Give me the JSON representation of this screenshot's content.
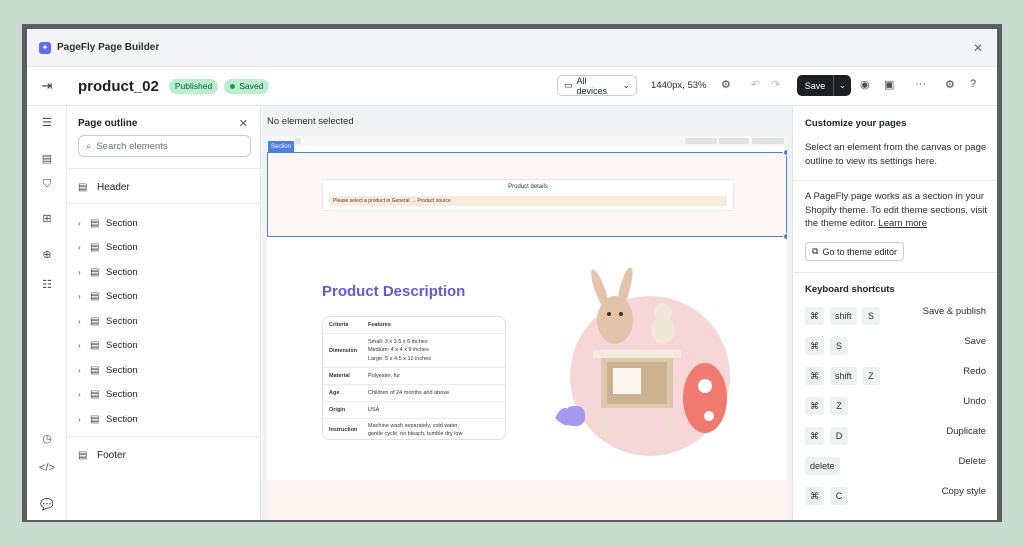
{
  "app": {
    "title": "PageFly Page Builder"
  },
  "topbar": {
    "page_name": "product_02",
    "status_published": "Published",
    "status_saved": "Saved",
    "device_select": "All devices",
    "zoom": "1440px, 53%",
    "save_label": "Save"
  },
  "outline": {
    "title": "Page outline",
    "search_placeholder": "Search elements",
    "header": "Header",
    "footer": "Footer",
    "sections": [
      "Section",
      "Section",
      "Section",
      "Section",
      "Section",
      "Section",
      "Section",
      "Section",
      "Section"
    ]
  },
  "canvas": {
    "status": "No element selected",
    "section_tag": "Section",
    "product_details_title": "Product details",
    "product_warning": "Please select a product in General → Product source",
    "description_title": "Product Description",
    "spec_header": [
      "Criteria",
      "Features"
    ],
    "spec_rows": [
      {
        "k": "Dimension",
        "v": "Small: 3 x 3.5 x 6 inches\nMedium: 4 x 4 x 9 inches\nLarge: 5 x 4.5 x 12 inches"
      },
      {
        "k": "Material",
        "v": "Polyester, fur"
      },
      {
        "k": "Age",
        "v": "Children of 24 months and above"
      },
      {
        "k": "Origin",
        "v": "USA"
      },
      {
        "k": "Instruction",
        "v": "Machine wash separately, cold water,\ngentle cycle, no bleach, tumble dry low"
      }
    ]
  },
  "panel": {
    "title": "Customize your pages",
    "intro": "Select an element from the canvas or page outline to view its settings here.",
    "theme_text": "A PageFly page works as a section in your Shopify theme. To edit theme sections, visit the theme editor.",
    "learn_more": "Learn more",
    "theme_editor_button": "Go to theme editor",
    "shortcuts_title": "Keyboard shortcuts",
    "shortcuts": [
      {
        "keys": [
          "⌘",
          "shift",
          "S"
        ],
        "label": "Save & publish"
      },
      {
        "keys": [
          "⌘",
          "S"
        ],
        "label": "Save"
      },
      {
        "keys": [
          "⌘",
          "shift",
          "Z"
        ],
        "label": "Redo"
      },
      {
        "keys": [
          "⌘",
          "Z"
        ],
        "label": "Undo"
      },
      {
        "keys": [
          "⌘",
          "D"
        ],
        "label": "Duplicate"
      },
      {
        "keys": [
          "delete"
        ],
        "label": "Delete"
      },
      {
        "keys": [
          "⌘",
          "C"
        ],
        "label": "Copy style"
      }
    ]
  },
  "colors": {
    "accent": "#4b7fe0",
    "heading_purple": "#6a55d8",
    "status_green": "#b9efcf"
  }
}
